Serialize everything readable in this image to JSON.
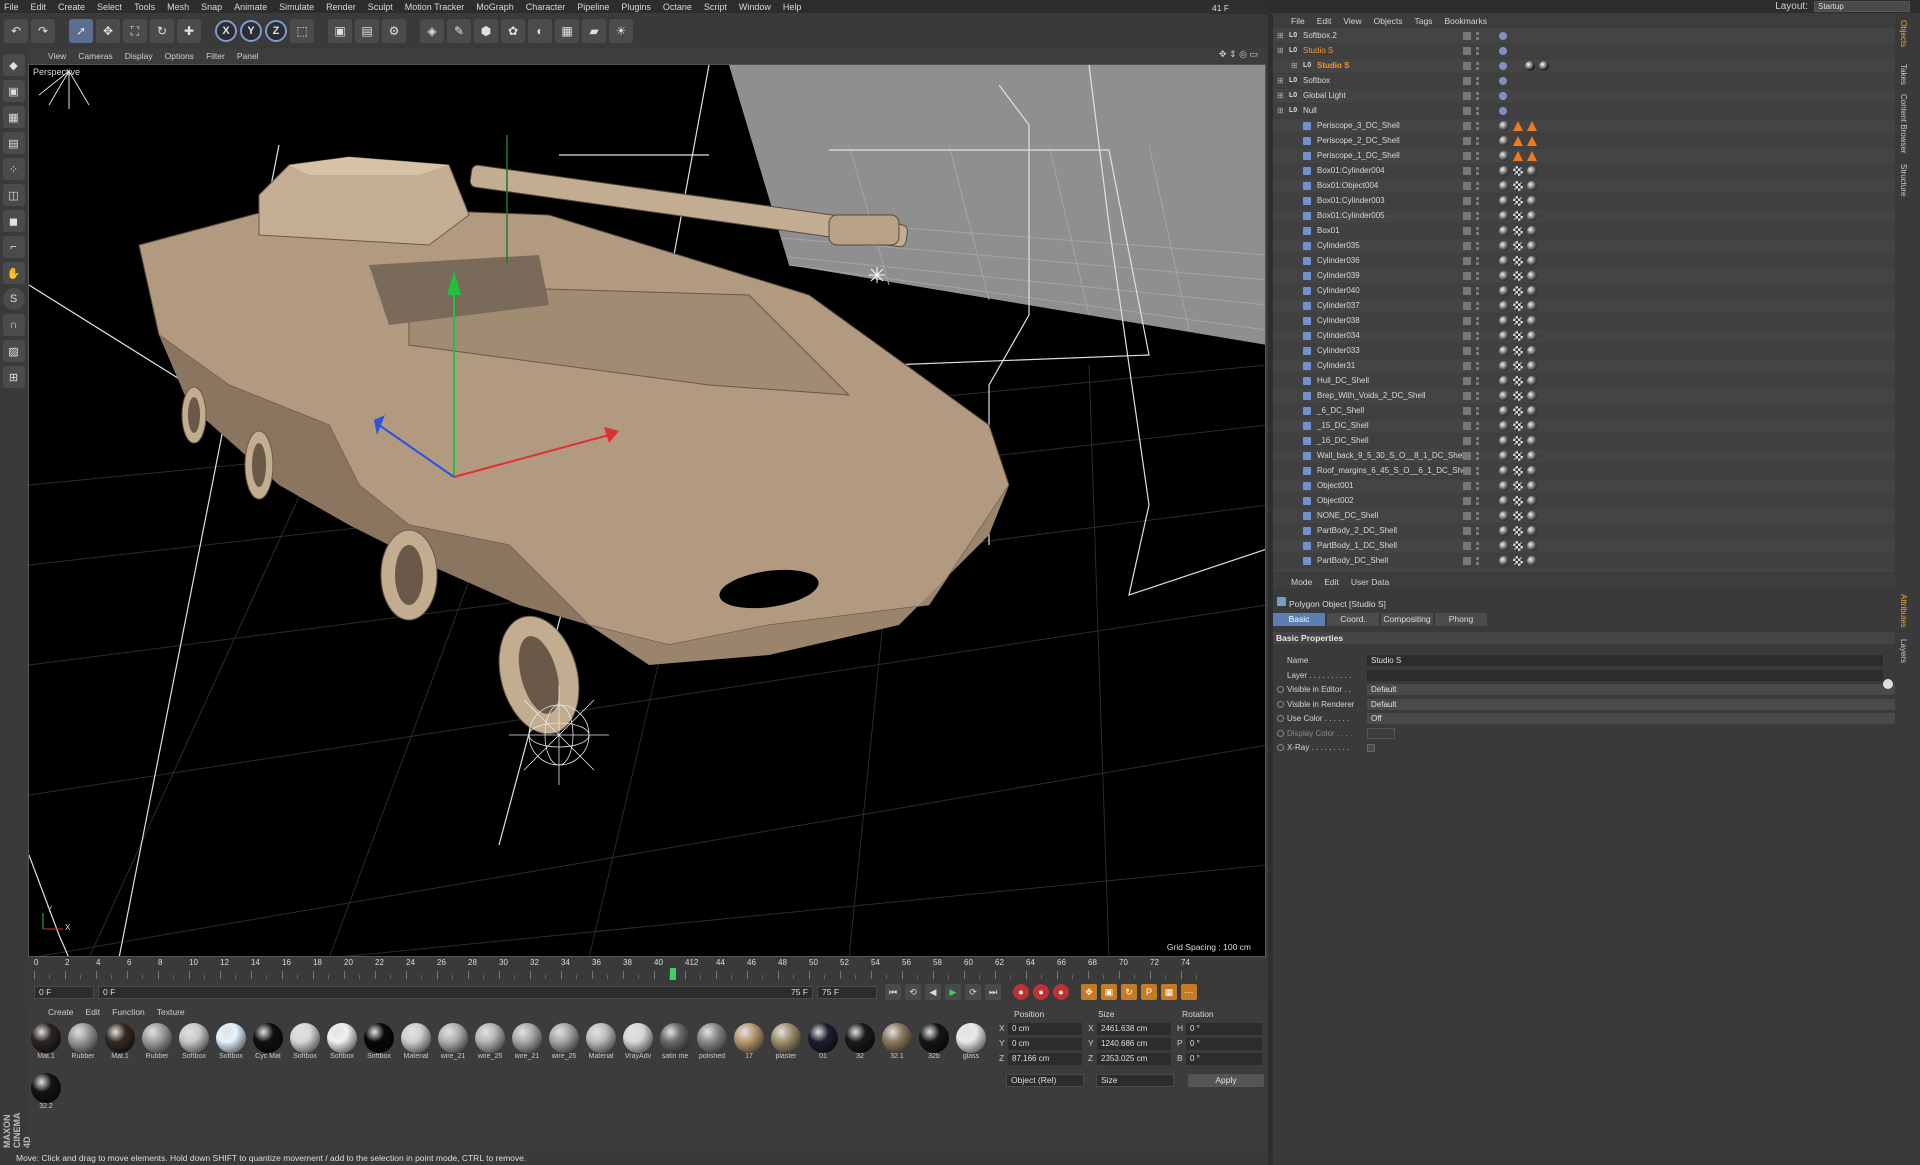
{
  "menubar": {
    "items": [
      "File",
      "Edit",
      "Create",
      "Select",
      "Tools",
      "Mesh",
      "Snap",
      "Animate",
      "Simulate",
      "Render",
      "Sculpt",
      "Motion Tracker",
      "MoGraph",
      "Character",
      "Pipeline",
      "Plugins",
      "Octane",
      "Script",
      "Window",
      "Help"
    ],
    "layout_label": "Layout:",
    "layout_value": "Startup"
  },
  "toolbar": {
    "icons": [
      "undo-icon",
      "redo-icon",
      "live-select-icon",
      "move-icon",
      "scale-icon",
      "rotate-icon",
      "create-icon",
      "x-axis-icon",
      "y-axis-icon",
      "z-axis-icon",
      "coordinate-system-icon",
      "render-view-icon",
      "render-picture-queue-icon",
      "edit-render-settings-icon",
      "cube-icon",
      "spline-pen-icon",
      "subdivision-icon",
      "cloner-icon",
      "deformer-icon",
      "floor-icon",
      "camera-icon",
      "light-icon"
    ],
    "axis_labels": [
      "X",
      "Y",
      "Z"
    ]
  },
  "left_toolbar": {
    "icons": [
      "make-editable-icon",
      "model-mode-icon",
      "texture-mode-icon",
      "workplane-icon",
      "points-mode-icon",
      "edges-mode-icon",
      "polygons-mode-icon",
      "axis-mode-icon",
      "tweak-mode-icon",
      "solo-icon",
      "magnet-icon",
      "lock-workplane-icon",
      "snap-icon"
    ],
    "solo_label": "S"
  },
  "viewport": {
    "menu": [
      "View",
      "Cameras",
      "Display",
      "Options",
      "Filter",
      "Panel"
    ],
    "camera_label": "Perspective",
    "grid_spacing": "Grid Spacing : 100 cm",
    "axis_x": "X",
    "axis_y": "Y"
  },
  "timeline": {
    "ticks": [
      "0",
      "2",
      "4",
      "6",
      "8",
      "10",
      "12",
      "14",
      "16",
      "18",
      "20",
      "22",
      "24",
      "26",
      "28",
      "30",
      "32",
      "34",
      "36",
      "38",
      "40",
      "412",
      "44",
      "46",
      "48",
      "50",
      "52",
      "54",
      "56",
      "58",
      "60",
      "62",
      "64",
      "66",
      "68",
      "70",
      "72",
      "74"
    ],
    "current_frame": 41,
    "frame_field": "41 F",
    "start_field": "0 F",
    "range_start": "0 F",
    "range_end": "75 F",
    "end_field": "75 F"
  },
  "transport": {
    "buttons": [
      "go-to-start-icon",
      "previous-key-icon",
      "play-backwards-icon",
      "play-icon",
      "next-key-icon",
      "go-to-end-icon"
    ],
    "record_buttons": [
      "record-active-objects-icon",
      "autokeying-icon",
      "keyframe-selection-icon"
    ],
    "key_buttons": [
      "position-key-icon",
      "scale-key-icon",
      "rotation-key-icon",
      "parameter-key-icon",
      "pla-key-icon",
      "interpolation-icon"
    ]
  },
  "materials": {
    "menu": [
      "Create",
      "Edit",
      "Function",
      "Texture"
    ],
    "items": [
      {
        "label": "Mat.1",
        "color": "#2a2520"
      },
      {
        "label": "Rubber",
        "color": "#9a9a9a"
      },
      {
        "label": "Mat.1",
        "color": "#352a22"
      },
      {
        "label": "Rubber",
        "color": "#a0a0a0"
      },
      {
        "label": "Softbox",
        "color": "#c8c8c8"
      },
      {
        "label": "Softbox",
        "color": "#e6f2ff"
      },
      {
        "label": "Cyc Mat",
        "color": "#101010"
      },
      {
        "label": "Softbox",
        "color": "#d8d8d8"
      },
      {
        "label": "Softbox",
        "color": "#f0f0f0"
      },
      {
        "label": "Softbox",
        "color": "#080808"
      },
      {
        "label": "Material",
        "color": "#cfcfcf"
      },
      {
        "label": "wire_21",
        "color": "#b0b0b0"
      },
      {
        "label": "wire_25",
        "color": "#b5b5b5"
      },
      {
        "label": "wire_21",
        "color": "#aaaaaa"
      },
      {
        "label": "wire_25",
        "color": "#a5a5a5"
      },
      {
        "label": "Material",
        "color": "#bcbcbc"
      },
      {
        "label": "VrayAdv",
        "color": "#d8d8d8"
      },
      {
        "label": "satin me",
        "color": "#6a6a6a"
      },
      {
        "label": "polished",
        "color": "#8a8a8a"
      },
      {
        "label": "17",
        "color": "#b89a70"
      },
      {
        "label": "plaster",
        "color": "#a09070"
      },
      {
        "label": "01",
        "color": "#1a2030"
      },
      {
        "label": "32",
        "color": "#1a1a1a"
      },
      {
        "label": "32.1",
        "color": "#8a7a60"
      },
      {
        "label": "32b",
        "color": "#151515"
      },
      {
        "label": "glass",
        "color": "#e8e8e8"
      },
      {
        "label": "32.2",
        "color": "#141414"
      }
    ]
  },
  "coordinates": {
    "headers": [
      "Position",
      "Size",
      "Rotation"
    ],
    "rows": [
      {
        "axis": "X",
        "pos": "0 cm",
        "size_axis": "X",
        "size": "2461.638 cm",
        "rot_axis": "H",
        "rot": "0 °"
      },
      {
        "axis": "Y",
        "pos": "0 cm",
        "size_axis": "Y",
        "size": "1240.686 cm",
        "rot_axis": "P",
        "rot": "0 °"
      },
      {
        "axis": "Z",
        "pos": "87.166 cm",
        "size_axis": "Z",
        "size": "2353.025 cm",
        "rot_axis": "B",
        "rot": "0 °"
      }
    ],
    "mode_select": "Object (Rel)",
    "size_select": "Size",
    "apply": "Apply"
  },
  "status": {
    "text": "Move: Click and drag to move elements. Hold down SHIFT to quantize movement / add to the selection in point mode, CTRL to remove.",
    "logo": "MAXON CINEMA 4D"
  },
  "objects": {
    "menu": [
      "File",
      "Edit",
      "View",
      "Objects",
      "Tags",
      "Bookmarks"
    ],
    "rows": [
      {
        "name": "Softbox.2",
        "indent": 0,
        "type": "lo",
        "sel": false
      },
      {
        "name": "Studio S",
        "indent": 0,
        "type": "lo",
        "sel": true
      },
      {
        "name": "Studio S",
        "indent": 1,
        "type": "lo",
        "sel": true,
        "bold": true
      },
      {
        "name": "Softbox",
        "indent": 0,
        "type": "lo",
        "sel": false
      },
      {
        "name": "Global Light",
        "indent": 0,
        "type": "lo",
        "sel": false
      },
      {
        "name": "Null",
        "indent": 0,
        "type": "lo",
        "sel": false
      },
      {
        "name": "Periscope_3_DC_Shell",
        "indent": 1,
        "type": "poly",
        "sel": false
      },
      {
        "name": "Periscope_2_DC_Shell",
        "indent": 1,
        "type": "poly",
        "sel": false
      },
      {
        "name": "Periscope_1_DC_Shell",
        "indent": 1,
        "type": "poly",
        "sel": false
      },
      {
        "name": "Box01:Cylinder004",
        "indent": 1,
        "type": "poly",
        "sel": false
      },
      {
        "name": "Box01:Object004",
        "indent": 1,
        "type": "poly",
        "sel": false
      },
      {
        "name": "Box01:Cylinder003",
        "indent": 1,
        "type": "poly",
        "sel": false
      },
      {
        "name": "Box01:Cylinder005",
        "indent": 1,
        "type": "poly",
        "sel": false
      },
      {
        "name": "Box01",
        "indent": 1,
        "type": "poly",
        "sel": false
      },
      {
        "name": "Cylinder035",
        "indent": 1,
        "type": "poly",
        "sel": false
      },
      {
        "name": "Cylinder036",
        "indent": 1,
        "type": "poly",
        "sel": false
      },
      {
        "name": "Cylinder039",
        "indent": 1,
        "type": "poly",
        "sel": false
      },
      {
        "name": "Cylinder040",
        "indent": 1,
        "type": "poly",
        "sel": false
      },
      {
        "name": "Cylinder037",
        "indent": 1,
        "type": "poly",
        "sel": false
      },
      {
        "name": "Cylinder038",
        "indent": 1,
        "type": "poly",
        "sel": false
      },
      {
        "name": "Cylinder034",
        "indent": 1,
        "type": "poly",
        "sel": false
      },
      {
        "name": "Cylinder033",
        "indent": 1,
        "type": "poly",
        "sel": false
      },
      {
        "name": "Cylinder31",
        "indent": 1,
        "type": "poly",
        "sel": false
      },
      {
        "name": "Hull_DC_Shell",
        "indent": 1,
        "type": "poly",
        "sel": false
      },
      {
        "name": "Brep_With_Voids_2_DC_Shell",
        "indent": 1,
        "type": "poly",
        "sel": false
      },
      {
        "name": "_6_DC_Shell",
        "indent": 1,
        "type": "poly",
        "sel": false
      },
      {
        "name": "_15_DC_Shell",
        "indent": 1,
        "type": "poly",
        "sel": false
      },
      {
        "name": "_16_DC_Shell",
        "indent": 1,
        "type": "poly",
        "sel": false
      },
      {
        "name": "Wall_back_9_5_30_S_O__8_1_DC_Shell",
        "indent": 1,
        "type": "poly",
        "sel": false
      },
      {
        "name": "Roof_margins_6_45_S_O__6_1_DC_Shell",
        "indent": 1,
        "type": "poly",
        "sel": false
      },
      {
        "name": "Object001",
        "indent": 1,
        "type": "poly",
        "sel": false
      },
      {
        "name": "Object002",
        "indent": 1,
        "type": "poly",
        "sel": false
      },
      {
        "name": "NONE_DC_Shell",
        "indent": 1,
        "type": "poly",
        "sel": false
      },
      {
        "name": "PartBody_2_DC_Shell",
        "indent": 1,
        "type": "poly",
        "sel": false
      },
      {
        "name": "PartBody_1_DC_Shell",
        "indent": 1,
        "type": "poly",
        "sel": false
      },
      {
        "name": "PartBody_DC_Shell",
        "indent": 1,
        "type": "poly",
        "sel": false
      }
    ]
  },
  "vertical_tabs": [
    "Objects",
    "Takes",
    "Content Browser",
    "Structure",
    "Attributes",
    "Layers"
  ],
  "attributes": {
    "menu": [
      "Mode",
      "Edit",
      "User Data"
    ],
    "title": "Polygon Object [Studio S]",
    "tabs": [
      "Basic",
      "Coord.",
      "Compositing",
      "Phong"
    ],
    "section": "Basic Properties",
    "props": [
      {
        "label": "Name",
        "value": "Studio S",
        "radio": false,
        "disabled": false
      },
      {
        "label": "Layer . . . . . . . . . .",
        "value": "",
        "radio": false,
        "disabled": false
      },
      {
        "label": "Visible in Editor . .",
        "value": "Default",
        "radio": true,
        "disabled": false
      },
      {
        "label": "Visible in Renderer",
        "value": "Default",
        "radio": true,
        "disabled": false
      },
      {
        "label": "Use Color . . . . . .",
        "value": "Off",
        "radio": true,
        "disabled": false
      },
      {
        "label": "Display Color . . . .",
        "value": "",
        "radio": true,
        "disabled": true
      },
      {
        "label": "X-Ray . . . . . . . . .",
        "value": "",
        "radio": true,
        "disabled": false
      }
    ]
  }
}
